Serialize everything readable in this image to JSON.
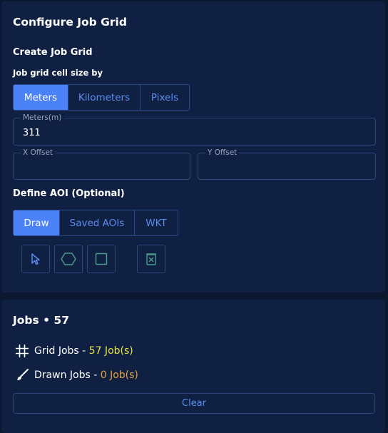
{
  "config": {
    "title": "Configure Job Grid",
    "create_heading": "Create Job Grid",
    "cell_size_label": "Job grid cell size by",
    "unit_tabs": [
      {
        "label": "Meters",
        "active": true
      },
      {
        "label": "Kilometers",
        "active": false
      },
      {
        "label": "Pixels",
        "active": false
      }
    ],
    "meters_field": {
      "label": "Meters(m)",
      "value": "311"
    },
    "x_offset_field": {
      "label": "X Offset",
      "value": ""
    },
    "y_offset_field": {
      "label": "Y Offset",
      "value": ""
    },
    "aoi_heading": "Define AOI (Optional)",
    "aoi_tabs": [
      {
        "label": "Draw",
        "active": true
      },
      {
        "label": "Saved AOIs",
        "active": false
      },
      {
        "label": "WKT",
        "active": false
      }
    ],
    "draw_tools": [
      "pointer-icon",
      "polygon-icon",
      "rectangle-icon",
      "delete-icon"
    ]
  },
  "jobs": {
    "title": "Jobs • 57",
    "grid_jobs": {
      "label": "Grid Jobs - ",
      "count": "57 Job(s)",
      "icon": "grid-icon"
    },
    "drawn_jobs": {
      "label": "Drawn Jobs - ",
      "count": "0 Job(s)",
      "icon": "brush-icon"
    },
    "clear_label": "Clear"
  },
  "colors": {
    "background": "#0c1730",
    "panel": "#102042",
    "accent": "#4c82f7",
    "link": "#5b8def",
    "grid_count": "#e6e24a",
    "drawn_count": "#e6a23c",
    "tool_icon": "#4a9b8e"
  }
}
